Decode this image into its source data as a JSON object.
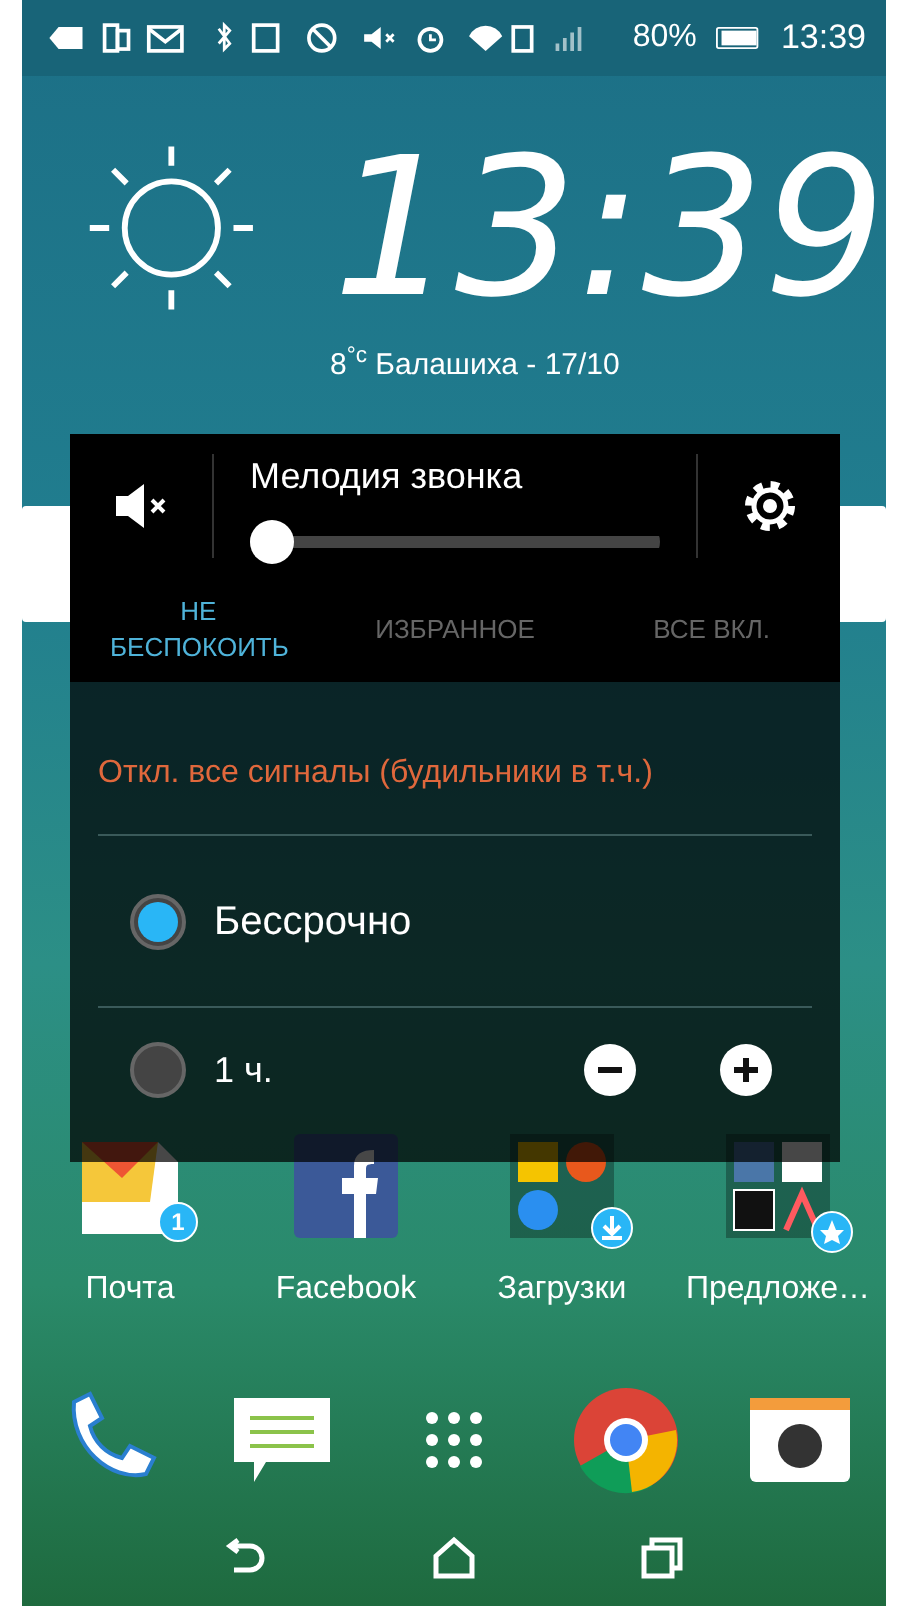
{
  "status_bar": {
    "battery": "80%",
    "time": "13:39"
  },
  "clock_widget": {
    "time": "13:39",
    "weather": "8$^{°c}$ Балашиха - 17/10"
  },
  "home_apps": [
    {
      "label": "Почта",
      "badge": "1"
    },
    {
      "label": "Facebook"
    },
    {
      "label": "Загрузки"
    },
    {
      "label": "Предложе…"
    }
  ],
  "sound_panel": {
    "title": "Мелодия звонка",
    "level": 0,
    "tabs": [
      {
        "label": "НЕ БЕСПОКОИТЬ",
        "selected": true
      },
      {
        "label": "ИЗБРАННОЕ",
        "selected": false
      },
      {
        "label": "ВСЕ ВКЛ.",
        "selected": false
      }
    ],
    "warning": "Откл. все сигналы (будильники в т.ч.)",
    "options": [
      {
        "label": "Бессрочно",
        "selected": true
      },
      {
        "label": "1 ч.",
        "selected": false
      }
    ]
  }
}
